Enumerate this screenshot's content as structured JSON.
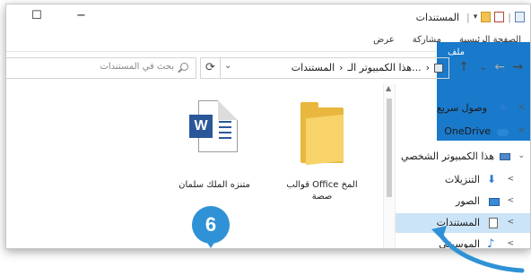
{
  "window": {
    "title": "المستندات",
    "minimize_icon": "−",
    "maximize_icon": "☐"
  },
  "ribbon": {
    "tabs": [
      "ملف",
      "الصفحة الرئيسية",
      "مشاركة",
      "عرض"
    ]
  },
  "address": {
    "segments": [
      "هذا الكمبيوتر الـ...",
      "المستندات"
    ],
    "separator": "›",
    "refresh_icon": "⟳",
    "dropdown_icon": "⌄"
  },
  "search": {
    "placeholder": "بحث في المستندات"
  },
  "nav_pane": {
    "items": [
      {
        "label": "وصول سريع",
        "icon": "star-icon"
      },
      {
        "label": "OneDrive",
        "icon": "cloud-icon"
      },
      {
        "label": "هذا الكمبيوتر الشخصي",
        "icon": "pc-icon"
      },
      {
        "label": "التنزيلات",
        "icon": "download-icon"
      },
      {
        "label": "الصور",
        "icon": "pictures-icon"
      },
      {
        "label": "المستندات",
        "icon": "documents-icon",
        "selected": true
      },
      {
        "label": "الموسيقى",
        "icon": "music-icon"
      }
    ]
  },
  "files": [
    {
      "name": "قوالب Office المخ\nصصة",
      "type": "folder"
    },
    {
      "name": "متنزه الملك سلمان",
      "type": "word-document"
    }
  ],
  "annotation": {
    "step_number": "6",
    "accent_color": "#2f92d6"
  },
  "colors": {
    "file_tab": "#1979ca",
    "selection": "#cce4f7"
  }
}
